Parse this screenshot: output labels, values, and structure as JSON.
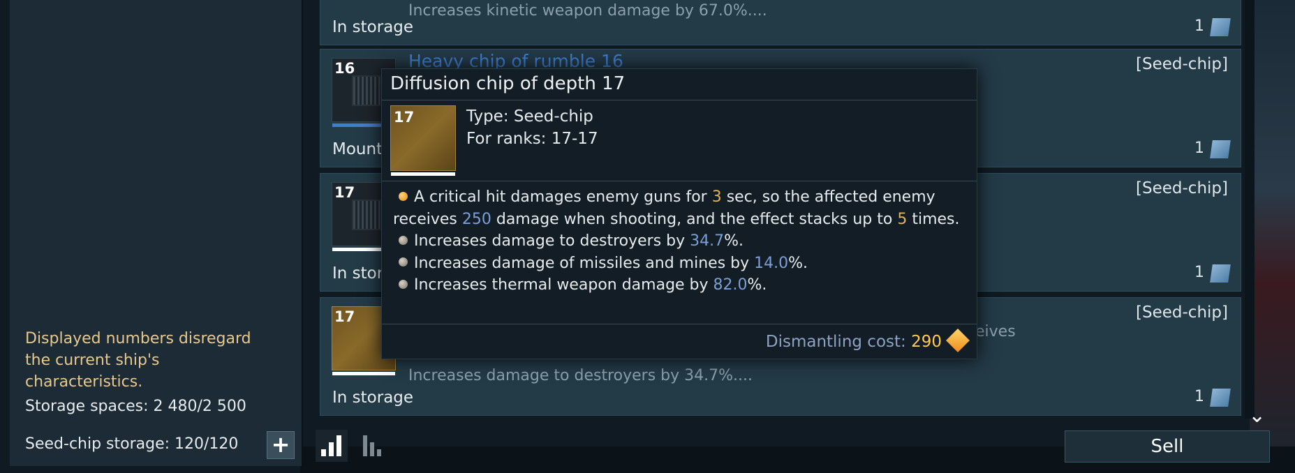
{
  "left_panel": {
    "warning": "Displayed numbers disregard the current ship's characteristics.",
    "storage_spaces": "Storage spaces: 2 480/2 500",
    "seedchip_storage": "Seed-chip storage: 120/120",
    "plus_symbol": "+"
  },
  "items": [
    {
      "desc": "Increases kinetic weapon damage by 67.0%....",
      "status": "In storage",
      "qty": "1"
    },
    {
      "name": "Heavy chip of rumble 16",
      "rank": "16",
      "tag": "[Seed-chip]",
      "status": "Mount",
      "qty": "1"
    },
    {
      "rank": "17",
      "tag": "[Seed-chip]",
      "status": "In stora",
      "qty": "1"
    },
    {
      "rank": "17",
      "tag": "[Seed-chip]",
      "desc_partial": "eives",
      "desc": "Increases damage to destroyers by 34.7%....",
      "status": "In storage",
      "qty": "1"
    }
  ],
  "tooltip": {
    "title": "Diffusion chip of depth 17",
    "rank": "17",
    "type": "Type: Seed-chip",
    "ranks": "For ranks: 17-17",
    "effect_main": {
      "p1": "A critical hit damages enemy guns for ",
      "v1": "3",
      "p2": " sec, so the affected enemy receives ",
      "v2": "250",
      "p3": " damage when shooting, and the effect stacks up to ",
      "v3": "5",
      "p4": " times."
    },
    "effects": [
      {
        "text": "Increases damage to destroyers by ",
        "value": "34.7",
        "suffix": "%."
      },
      {
        "text": "Increases damage of missiles and mines by ",
        "value": "14.0",
        "suffix": "%."
      },
      {
        "text": "Increases thermal weapon damage by ",
        "value": "82.0",
        "suffix": "%."
      }
    ],
    "cost_label": "Dismantling cost: ",
    "cost_value": "290"
  },
  "bottom": {
    "sell_label": "Sell"
  },
  "icons": [
    "plus-icon",
    "stats-bars-icon",
    "stats-bars-alt-icon",
    "chevron-down-icon",
    "cargo-box-icon",
    "crystal-icon",
    "chip-icon"
  ]
}
